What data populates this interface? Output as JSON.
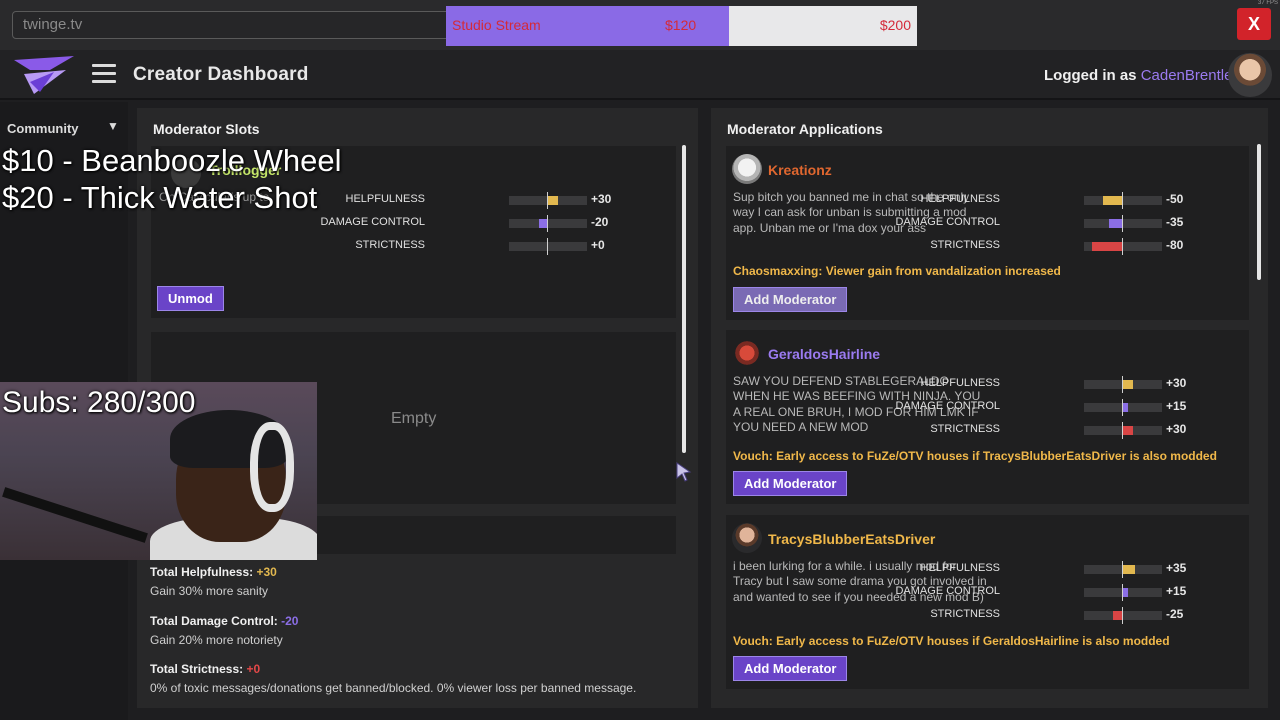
{
  "browser": {
    "url": "twinge.tv",
    "close_label": "X",
    "fps": "37 FPS"
  },
  "goal": {
    "label": "Studio Stream",
    "current": "$120",
    "target": "$200",
    "progress_fraction": 0.6,
    "fill_color": "#8a6ae6"
  },
  "header": {
    "title": "Creator Dashboard",
    "logged_in_prefix": "Logged in as ",
    "username": "CadenBrentley"
  },
  "sidebar": {
    "section": "Community"
  },
  "moderator_slots": {
    "title": "Moderator Slots",
    "slot1": {
      "name": "Trolllogger",
      "message_partial": "On Calvicular's up to",
      "unmod_label": "Unmod",
      "stats": [
        {
          "label": "HELPFULNESS",
          "value": "+30",
          "num": 30,
          "color": "#e2b84f"
        },
        {
          "label": "DAMAGE CONTROL",
          "value": "-20",
          "num": -20,
          "color": "#8b6ee6"
        },
        {
          "label": "STRICTNESS",
          "value": "+0",
          "num": 0,
          "color": "#d94545"
        }
      ]
    },
    "slot2": {
      "empty_label": "Empty"
    },
    "totals": {
      "helpfulness_label": "Total Helpfulness: ",
      "helpfulness_value": "+30",
      "helpfulness_desc": "Gain 30% more sanity",
      "damage_label": "Total Damage Control: ",
      "damage_value": "-20",
      "damage_desc": "Gain 20% more notoriety",
      "strictness_label": "Total Strictness: ",
      "strictness_value": "+0",
      "strictness_desc": "0% of toxic messages/donations get banned/blocked. 0% viewer loss per banned message."
    }
  },
  "applications": {
    "title": "Moderator Applications",
    "add_label": "Add Moderator",
    "items": [
      {
        "name": "Kreationz",
        "name_color": "#e0672f",
        "message": "Sup bitch you banned me in chat so the only way I can ask for unban is submitting a mod app. Unban me or I'ma dox your ass",
        "perk": "Chaosmaxxing: Viewer gain from vandalization increased",
        "button_disabled": true,
        "stats": [
          {
            "label": "HELPFULNESS",
            "value": "-50",
            "num": -50,
            "color": "#e2b84f"
          },
          {
            "label": "DAMAGE CONTROL",
            "value": "-35",
            "num": -35,
            "color": "#8b6ee6"
          },
          {
            "label": "STRICTNESS",
            "value": "-80",
            "num": -80,
            "color": "#d94545"
          }
        ]
      },
      {
        "name": "GeraldosHairline",
        "name_color": "#9b7bf0",
        "message": "SAW YOU DEFEND STABLEGERALDO WHEN HE WAS BEEFING WITH NINJA. YOU A REAL ONE BRUH, I MOD FOR HIM LMK IF YOU NEED A NEW MOD",
        "perk": "Vouch: Early access to FuZe/OTV houses if TracysBlubberEatsDriver is also modded",
        "button_disabled": false,
        "stats": [
          {
            "label": "HELPFULNESS",
            "value": "+30",
            "num": 30,
            "color": "#e2b84f"
          },
          {
            "label": "DAMAGE CONTROL",
            "value": "+15",
            "num": 15,
            "color": "#8b6ee6"
          },
          {
            "label": "STRICTNESS",
            "value": "+30",
            "num": 30,
            "color": "#d94545"
          }
        ]
      },
      {
        "name": "TracysBlubberEatsDriver",
        "name_color": "#f0b84a",
        "message": "i been lurking for a while. i usually mod for Tracy but I saw some drama you got involved in and wanted to see if you needed a new mod B)",
        "perk": "Vouch: Early access to FuZe/OTV houses if GeraldosHairline is also modded",
        "button_disabled": false,
        "stats": [
          {
            "label": "HELPFULNESS",
            "value": "+35",
            "num": 35,
            "color": "#e2b84f"
          },
          {
            "label": "DAMAGE CONTROL",
            "value": "+15",
            "num": 15,
            "color": "#8b6ee6"
          },
          {
            "label": "STRICTNESS",
            "value": "-25",
            "num": -25,
            "color": "#d94545"
          }
        ]
      }
    ]
  },
  "stream_overlay": {
    "line1": "$10 - Beanboozle Wheel",
    "line2": "$20 - Thick Water Shot",
    "subs": "Subs: 280/300"
  }
}
